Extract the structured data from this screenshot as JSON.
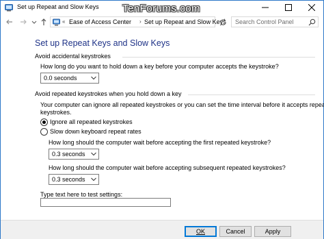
{
  "window": {
    "title": "Set up Repeat and Slow Keys",
    "watermark": "TenForums.com"
  },
  "navbar": {
    "breadcrumb": [
      "Ease of Access Center",
      "Set up Repeat and Slow Keys"
    ],
    "search_placeholder": "Search Control Panel"
  },
  "content": {
    "heading": "Set up Repeat Keys and Slow Keys",
    "section1": {
      "label": "Avoid accidental keystrokes",
      "question": "How long do you want to hold down a key before your computer accepts the keystroke?",
      "selected": "0.0 seconds"
    },
    "section2": {
      "label": "Avoid repeated keystrokes when you hold down a key",
      "description_line1": "Your computer can ignore all repeated keystrokes or you can set the time interval before it accepts repeated",
      "description_line2": "keystrokes.",
      "option_ignore": "Ignore all repeated keystrokes",
      "option_ignore_underline": "g",
      "option_slow": "Slow down keyboard repeat rates",
      "selected_option": "ignore",
      "first_question": "How long should the computer wait before accepting the first repeated keystroke?",
      "first_selected": "0.3 seconds",
      "subsequent_question": "How long should the computer wait before accepting subsequent repeated keystrokes?",
      "subsequent_selected": "0.3 seconds"
    },
    "test_label": "Type text here to test settings:",
    "test_value": ""
  },
  "buttons": {
    "ok": "OK",
    "cancel": "Cancel",
    "apply": "Apply"
  },
  "colors": {
    "heading": "#1e3287",
    "window_border": "#2b77c8",
    "ok_border": "#0078d7"
  }
}
